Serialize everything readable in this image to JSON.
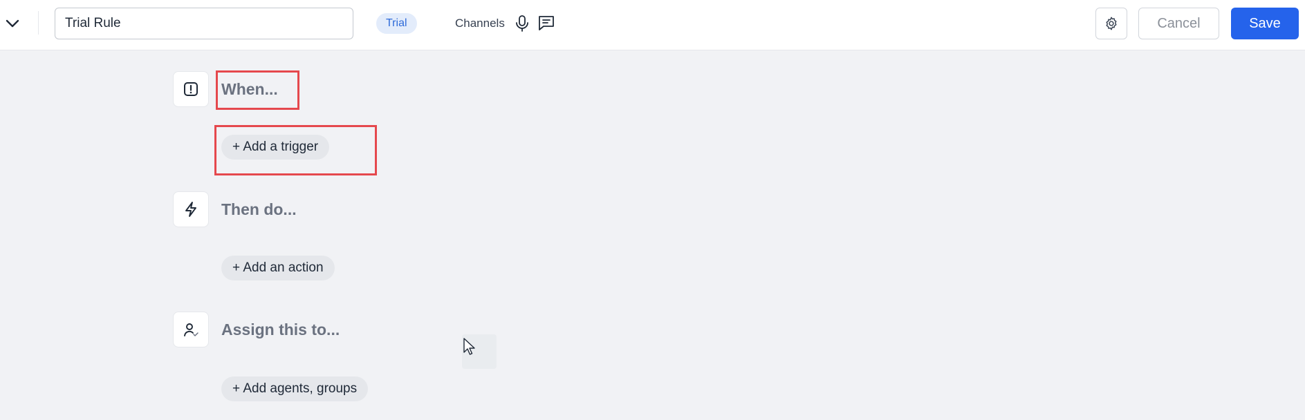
{
  "header": {
    "rule_name": "Trial Rule",
    "badge": "Trial",
    "channels_label": "Channels",
    "cancel_label": "Cancel",
    "save_label": "Save"
  },
  "sections": [
    {
      "title": "When...",
      "button": "+ Add a trigger",
      "icon": "alert-square-icon"
    },
    {
      "title": "Then do...",
      "button": "+ Add an action",
      "icon": "lightning-icon"
    },
    {
      "title": "Assign this to...",
      "button": "+ Add agents, groups",
      "icon": "user-check-icon"
    }
  ],
  "colors": {
    "accent": "#2563eb",
    "badge_bg": "#e3ecfb",
    "badge_text": "#2f6bd9",
    "highlight": "#e5484d",
    "page_bg": "#f1f2f5"
  }
}
